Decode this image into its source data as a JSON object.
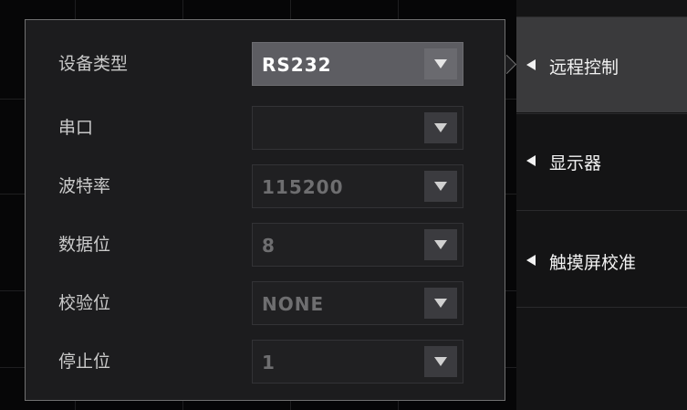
{
  "settings": {
    "rows": [
      {
        "label": "设备类型",
        "value": "RS232",
        "active": true
      },
      {
        "label": "串口",
        "value": "",
        "active": false
      },
      {
        "label": "波特率",
        "value": "115200",
        "active": false
      },
      {
        "label": "数据位",
        "value": "8",
        "active": false
      },
      {
        "label": "校验位",
        "value": "NONE",
        "active": false
      },
      {
        "label": "停止位",
        "value": "1",
        "active": false
      }
    ]
  },
  "menu": {
    "items": [
      {
        "label": "远程控制",
        "active": true
      },
      {
        "label": "显示器",
        "active": false
      },
      {
        "label": "触摸屏校准",
        "active": false
      }
    ]
  },
  "icons": {
    "dropdown": "triangle-down-icon",
    "menu_arrow": "triangle-left-icon"
  },
  "colors": {
    "panel_bg": "#1c1c1e",
    "panel_border": "#707070",
    "active_item": "#3a3a3c",
    "text": "#c9c9c9"
  }
}
